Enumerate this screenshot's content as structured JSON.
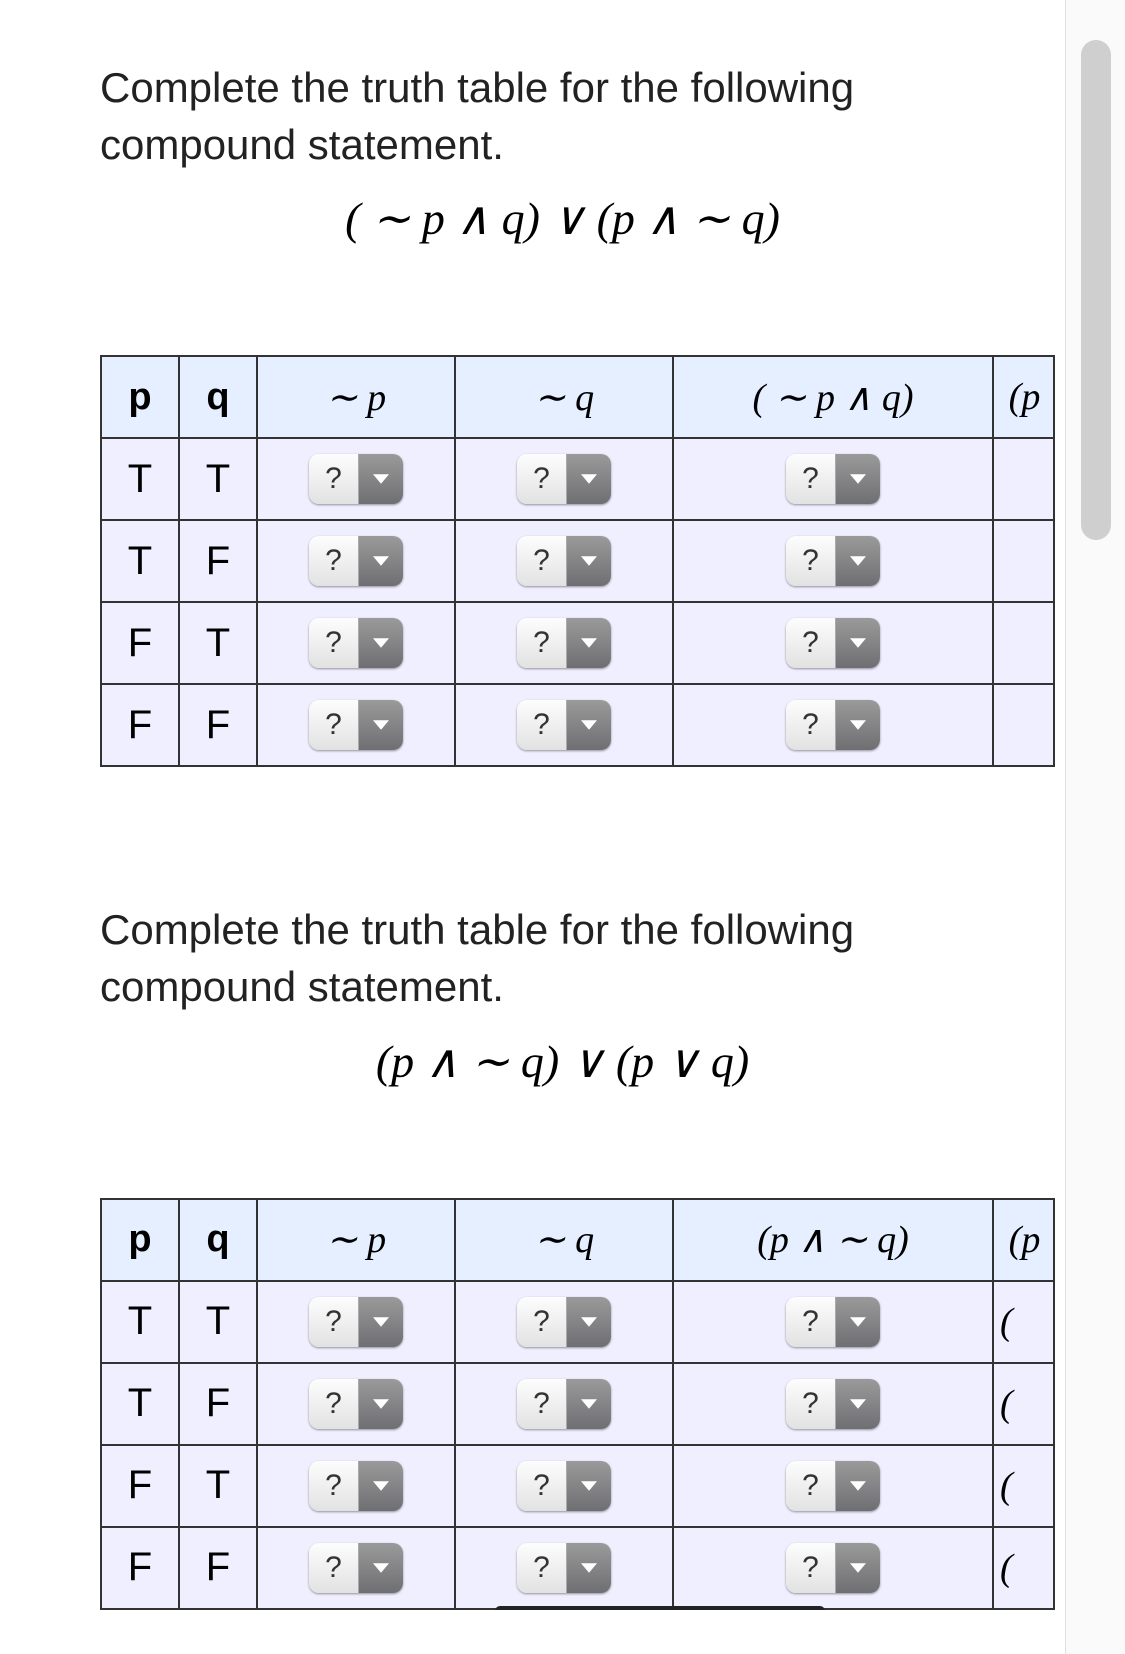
{
  "problem1": {
    "prompt": "Complete the truth table for the following compound statement.",
    "formula": "( ∼ p ∧ q) ∨ (p ∧  ∼ q)",
    "headers": {
      "p": "p",
      "q": "q",
      "notp": "∼ p",
      "notq": "∼ q",
      "compound": "( ∼ p ∧ q)",
      "last": "(p"
    },
    "rows": [
      {
        "p": "T",
        "q": "T"
      },
      {
        "p": "T",
        "q": "F"
      },
      {
        "p": "F",
        "q": "T"
      },
      {
        "p": "F",
        "q": "F"
      }
    ],
    "dropdown_placeholder": "?"
  },
  "problem2": {
    "prompt": "Complete the truth table for the following compound statement.",
    "formula": "(p ∧  ∼ q) ∨ (p ∨ q)",
    "headers": {
      "p": "p",
      "q": "q",
      "notp": "∼ p",
      "notq": "∼ q",
      "compound": "(p ∧  ∼ q)",
      "last": "(p"
    },
    "rows": [
      {
        "p": "T",
        "q": "T"
      },
      {
        "p": "T",
        "q": "F"
      },
      {
        "p": "F",
        "q": "T"
      },
      {
        "p": "F",
        "q": "F"
      }
    ],
    "dropdown_placeholder": "?"
  }
}
